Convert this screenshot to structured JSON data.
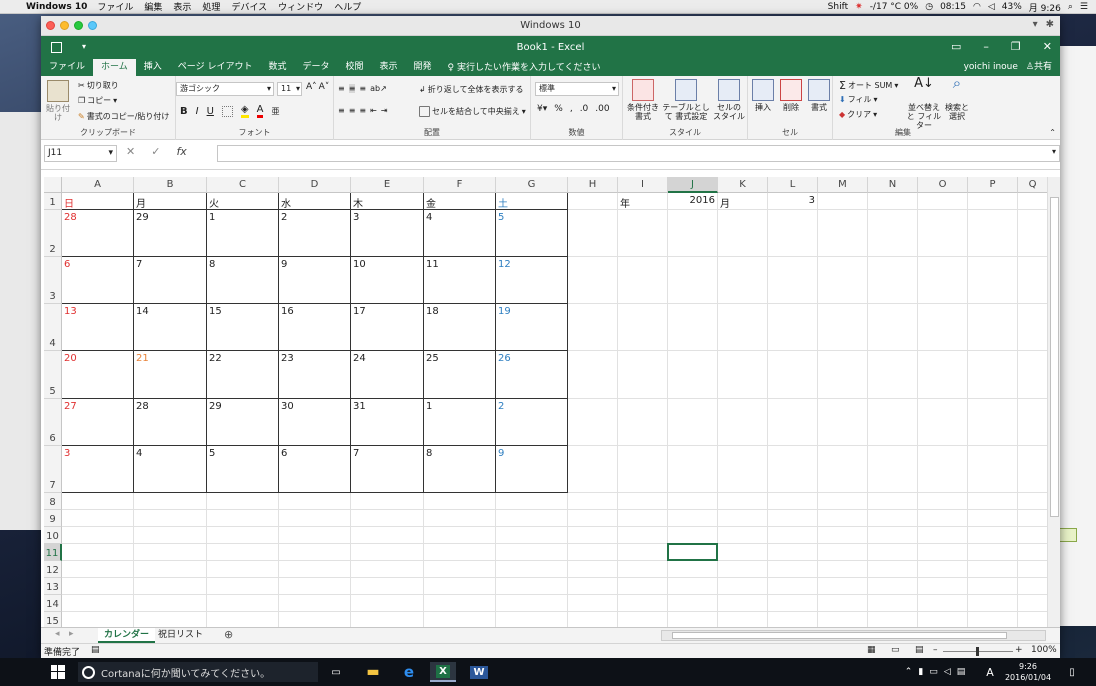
{
  "mac_menu": {
    "app": "Windows 10",
    "items": [
      "ファイル",
      "編集",
      "表示",
      "処理",
      "デバイス",
      "ウィンドウ",
      "ヘルプ"
    ],
    "status": {
      "shift": "Shift",
      "weather": "-/17 °C 0%",
      "clock1": "08:15",
      "battery": "43%",
      "time": "月 9:26"
    }
  },
  "vm_title": "Windows 10",
  "excel": {
    "title": "Book1 - Excel",
    "tabs": [
      "ファイル",
      "ホーム",
      "挿入",
      "ページ レイアウト",
      "数式",
      "データ",
      "校閲",
      "表示",
      "開発"
    ],
    "tellme": "実行したい作業を入力してください",
    "user": "yoichi inoue",
    "share": "共有",
    "ribbon": {
      "paste": "貼り付け",
      "cut": "切り取り",
      "copy": "コピー",
      "format_painter": "書式のコピー/貼り付け",
      "clipboard": "クリップボード",
      "font_name": "游ゴシック",
      "font_size": "11",
      "font_group": "フォント",
      "wrap": "折り返して全体を表示する",
      "merge": "セルを結合して中央揃え",
      "align_group": "配置",
      "num_format": "標準",
      "num_group": "数値",
      "cond_format": "条件付き 書式",
      "table_format": "テーブルとして 書式設定",
      "cell_style": "セルの スタイル",
      "style_group": "スタイル",
      "insert": "挿入",
      "delete": "削除",
      "format": "書式",
      "cells_group": "セル",
      "autosum": "オート SUM",
      "fill": "フィル",
      "clear": "クリア",
      "sort": "並べ替えと フィルター",
      "find": "検索と 選択",
      "edit_group": "編集"
    },
    "namebox": "J11",
    "columns": [
      "A",
      "B",
      "C",
      "D",
      "E",
      "F",
      "G",
      "H",
      "I",
      "J",
      "K",
      "L",
      "M",
      "N",
      "O",
      "P",
      "Q"
    ],
    "rows": [
      "1",
      "2",
      "3",
      "4",
      "5",
      "6",
      "7",
      "8",
      "9",
      "10",
      "11",
      "12",
      "13",
      "14",
      "15"
    ],
    "weekdays": [
      "日",
      "月",
      "火",
      "水",
      "木",
      "金",
      "土"
    ],
    "weeks": [
      [
        "28",
        "29",
        "1",
        "2",
        "3",
        "4",
        "5"
      ],
      [
        "6",
        "7",
        "8",
        "9",
        "10",
        "11",
        "12"
      ],
      [
        "13",
        "14",
        "15",
        "16",
        "17",
        "18",
        "19"
      ],
      [
        "20",
        "21",
        "22",
        "23",
        "24",
        "25",
        "26"
      ],
      [
        "27",
        "28",
        "29",
        "30",
        "31",
        "1",
        "2"
      ],
      [
        "3",
        "4",
        "5",
        "6",
        "7",
        "8",
        "9"
      ]
    ],
    "side": {
      "year_label": "年",
      "year": "2016",
      "month_label": "月",
      "month": "3"
    },
    "colors": {
      "sunday": "#e03030",
      "saturday": "#2f7fc1",
      "holiday": "#e8833a",
      "excel_green": "#217346"
    },
    "sheets": [
      "カレンダー",
      "祝日リスト"
    ],
    "status": "準備完了",
    "zoom": "100%"
  },
  "taskbar": {
    "cortana": "Cortanaに何か聞いてみてください。",
    "time": "9:26",
    "date": "2016/01/04",
    "ime": "A"
  }
}
